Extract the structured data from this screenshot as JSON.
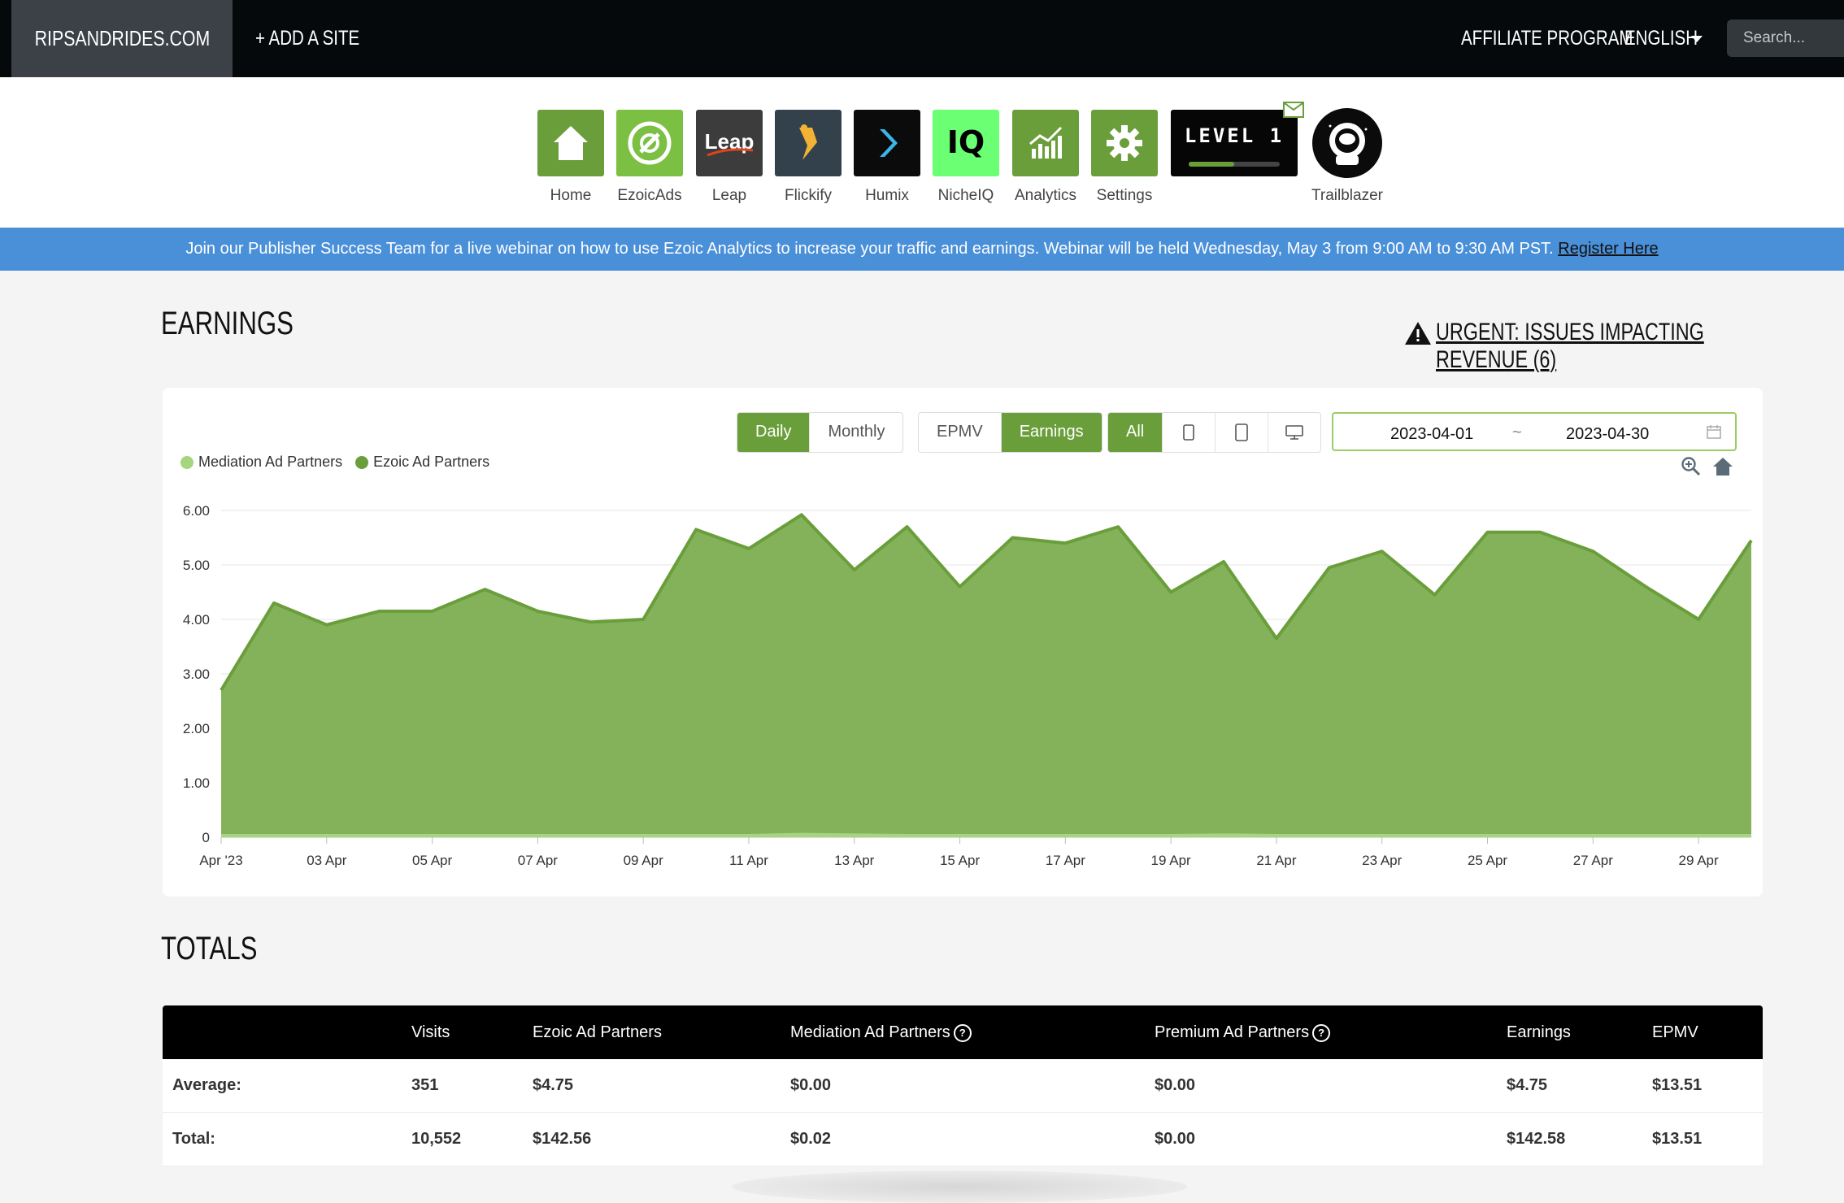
{
  "topnav": {
    "brand": "RIPSANDRIDES.COM",
    "add_site": "+ ADD A SITE",
    "affiliate": "AFFILIATE PROGRAM",
    "language": "ENGLISH",
    "search_placeholder": "Search..."
  },
  "apps": [
    {
      "label": "Home",
      "icon": "home-icon"
    },
    {
      "label": "EzoicAds",
      "icon": "ezoicads-icon"
    },
    {
      "label": "Leap",
      "icon": "leap-icon",
      "icon_text": "Leap"
    },
    {
      "label": "Flickify",
      "icon": "flickify-icon"
    },
    {
      "label": "Humix",
      "icon": "humix-icon"
    },
    {
      "label": "NicheIQ",
      "icon": "nicheiq-icon",
      "icon_text": "IQ"
    },
    {
      "label": "Analytics",
      "icon": "analytics-icon"
    },
    {
      "label": "Settings",
      "icon": "gear-icon"
    }
  ],
  "level": {
    "text": "LEVEL 1",
    "progress": 0.5
  },
  "trailblazer": {
    "label": "Trailblazer"
  },
  "banner": {
    "text": "Join our Publisher Success Team for a live webinar on how to use Ezoic Analytics to increase your traffic and earnings. Webinar will be held Wednesday, May 3 from 9:00 AM to 9:30 AM PST.",
    "link": "Register Here"
  },
  "earnings": {
    "title": "EARNINGS",
    "urgent": "URGENT: ISSUES IMPACTING REVENUE (6)",
    "period_buttons": [
      "Daily",
      "Monthly"
    ],
    "period_selected": "Daily",
    "metric_buttons": [
      "EPMV",
      "Earnings"
    ],
    "metric_selected": "Earnings",
    "device_all": "All",
    "date_from": "2023-04-01",
    "date_sep": "~",
    "date_to": "2023-04-30"
  },
  "chart_data": {
    "type": "area",
    "series": [
      {
        "name": "Mediation Ad Partners",
        "color": "#a5d67f",
        "values": [
          0,
          0,
          0,
          0,
          0,
          0,
          0,
          0,
          0,
          0,
          0,
          0.02,
          0.01,
          0,
          0,
          0,
          0,
          0,
          0,
          0.01,
          0,
          0,
          0,
          0,
          0,
          0,
          0,
          0,
          0,
          0
        ]
      },
      {
        "name": "Ezoic Ad Partners",
        "color": "#6a9e3a",
        "values": [
          2.7,
          4.3,
          3.9,
          4.15,
          4.15,
          4.55,
          4.15,
          3.95,
          4.0,
          5.65,
          5.3,
          5.9,
          4.9,
          5.7,
          4.6,
          5.5,
          5.4,
          5.7,
          4.5,
          5.05,
          3.65,
          4.95,
          5.25,
          4.45,
          5.6,
          5.6,
          5.25,
          4.6,
          4.0,
          5.45
        ]
      }
    ],
    "x_labels": [
      "Apr '23",
      "03 Apr",
      "05 Apr",
      "07 Apr",
      "09 Apr",
      "11 Apr",
      "13 Apr",
      "15 Apr",
      "17 Apr",
      "19 Apr",
      "21 Apr",
      "23 Apr",
      "25 Apr",
      "27 Apr",
      "29 Apr"
    ],
    "y_ticks": [
      "0",
      "1.00",
      "2.00",
      "3.00",
      "4.00",
      "5.00",
      "6.00"
    ],
    "ylim": [
      0,
      6
    ],
    "grid": true,
    "legend_position": "top-left"
  },
  "totals": {
    "title": "TOTALS",
    "columns": [
      "",
      "Visits",
      "Ezoic Ad Partners",
      "Mediation Ad Partners",
      "Premium Ad Partners",
      "Earnings",
      "EPMV"
    ],
    "rows": [
      [
        "Average:",
        "351",
        "$4.75",
        "$0.00",
        "$0.00",
        "$4.75",
        "$13.51"
      ],
      [
        "Total:",
        "10,552",
        "$142.56",
        "$0.02",
        "$0.00",
        "$142.58",
        "$13.51"
      ]
    ]
  }
}
